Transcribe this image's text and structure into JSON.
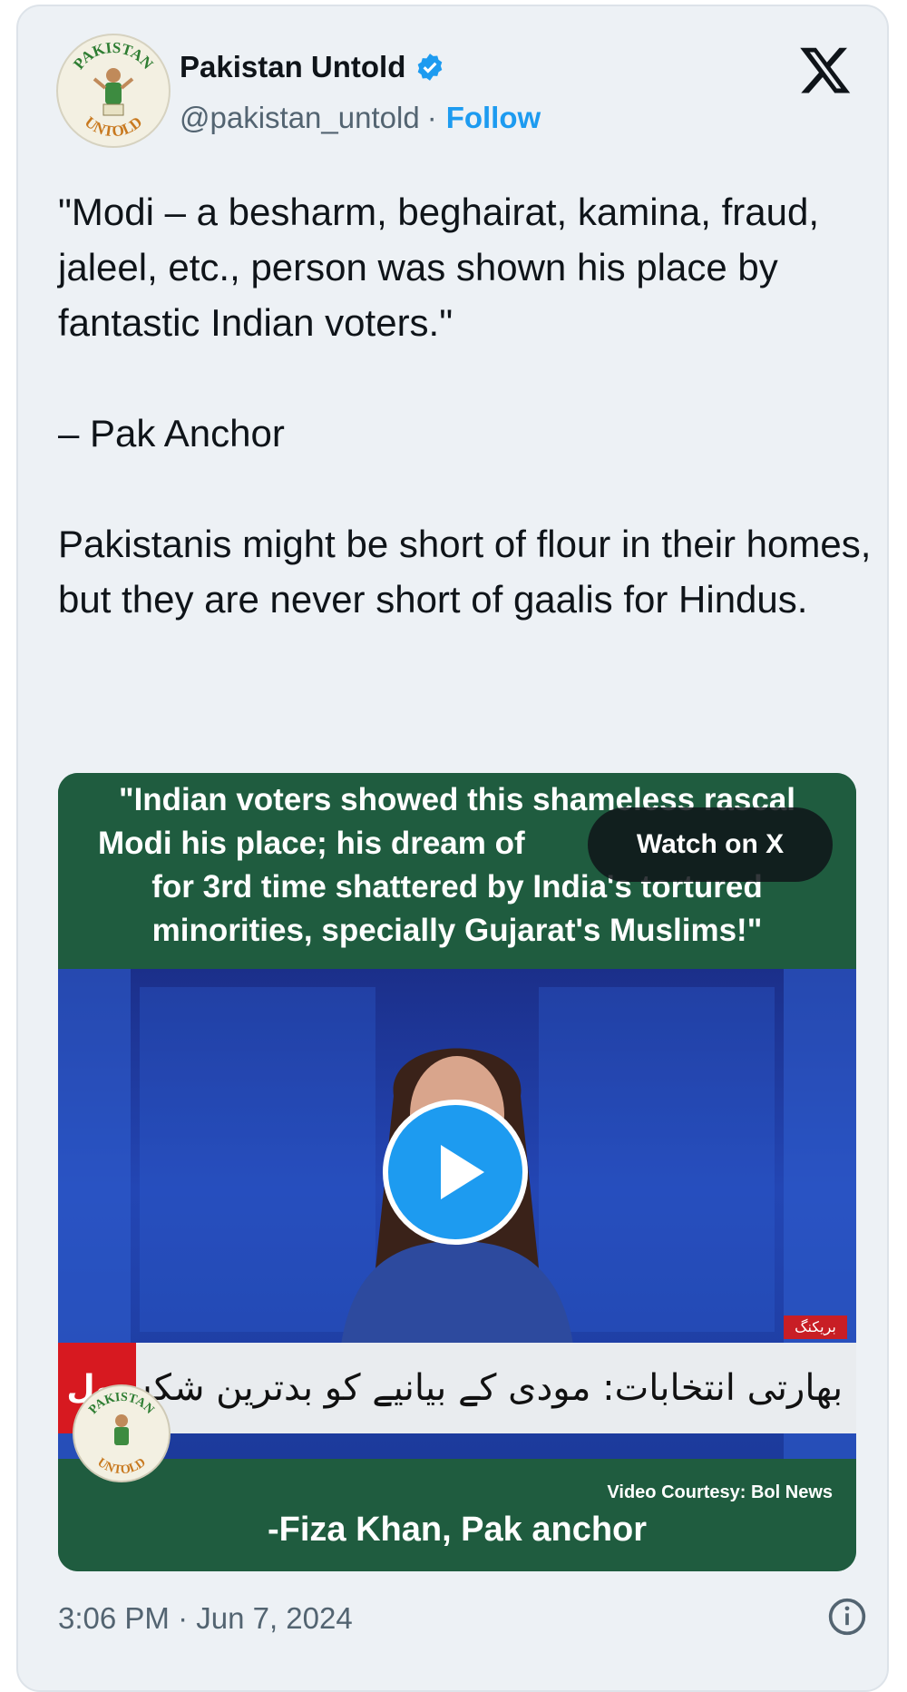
{
  "author": {
    "name": "Pakistan Untold",
    "handle": "@pakistan_untold",
    "separator": "·",
    "follow_label": "Follow",
    "avatar_text_top": "PAKISTAN",
    "avatar_text_bottom": "UNTOLD"
  },
  "tweet": {
    "text": "\"Modi – a besharm, beghairat, kamina, fraud, jaleel, etc., person was shown his place by fantastic Indian voters.\"\n\n– Pak Anchor\n\nPakistanis might be short of flour in their homes, but they are never short of gaalis for Hindus."
  },
  "media": {
    "headline_lines": [
      "\"Indian voters showed this shameless rascal",
      "Modi his place; his dream of",
      "for 3rd time shattered by India's tortured",
      "minorities, specially Gujarat's Muslims!\""
    ],
    "watch_label": "Watch on X",
    "ticker_text": "بھارتی انتخابات: مودی کے بیانیے کو بدترین شکست!",
    "channel_logo": "بول",
    "news_tag": "بریکنگ",
    "courtesy": "Video Courtesy: Bol News",
    "credit": "-Fiza Khan, Pak anchor",
    "accent_green": "#1f5c3f",
    "play_color": "#1d9bf0"
  },
  "meta": {
    "timestamp": "3:06 PM · Jun 7, 2024"
  },
  "icons": [
    "verified-badge-icon",
    "x-logo-icon",
    "play-icon",
    "info-icon"
  ]
}
